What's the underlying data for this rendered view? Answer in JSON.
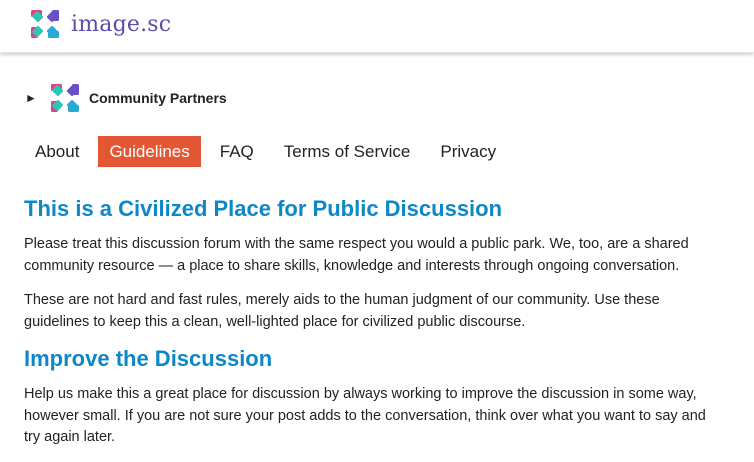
{
  "site": {
    "logo_text": "image.sc",
    "logo_icon": "image-sc-logo-icon",
    "brand_color": "#5a4fa8"
  },
  "breadcrumb": {
    "toggle_glyph": "►",
    "category_icon": "community-partners-icon",
    "category": "Community Partners"
  },
  "nav": {
    "items": [
      {
        "label": "About"
      },
      {
        "label": "Guidelines"
      },
      {
        "label": "FAQ"
      },
      {
        "label": "Terms of Service"
      },
      {
        "label": "Privacy"
      }
    ],
    "active": "Guidelines",
    "active_color": "#e45735"
  },
  "content": {
    "heading_color": "#0e87c7",
    "section1": {
      "heading": "This is a Civilized Place for Public Discussion",
      "paragraphs": [
        "Please treat this discussion forum with the same respect you would a public park. We, too, are a shared community resource — a place to share skills, knowledge and interests through ongoing conversation.",
        "These are not hard and fast rules, merely aids to the human judgment of our community. Use these guidelines to keep this a clean, well-lighted place for civilized public discourse."
      ]
    },
    "section2": {
      "heading": "Improve the Discussion",
      "paragraphs": [
        "Help us make this a great place for discussion by always working to improve the discussion in some way, however small. If you are not sure your post adds to the conversation, think over what you want to say and try again later."
      ]
    }
  }
}
